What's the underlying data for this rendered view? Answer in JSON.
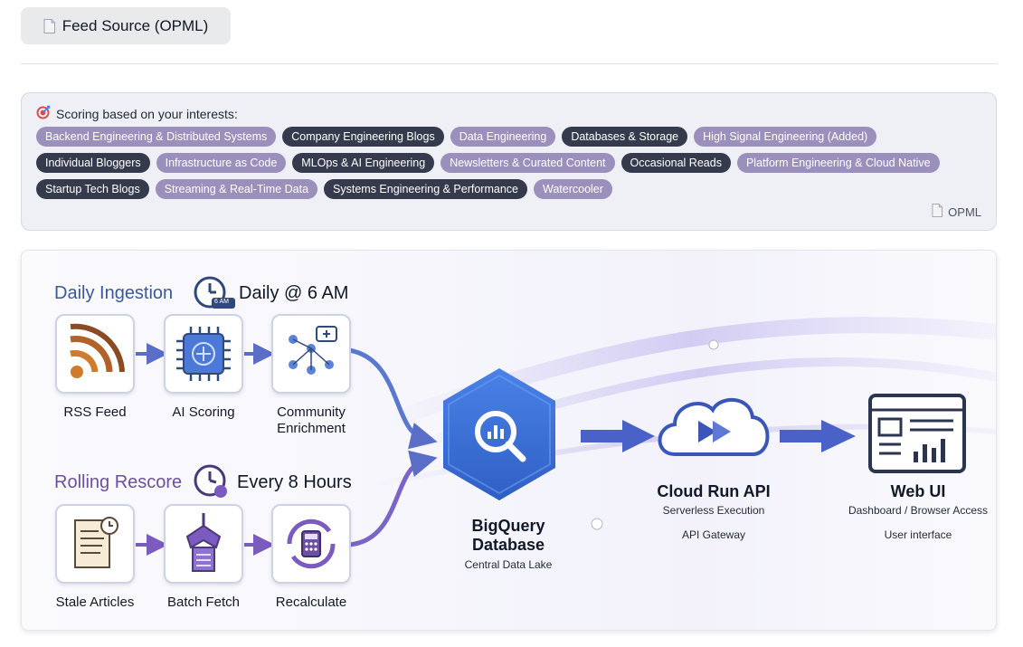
{
  "header": {
    "feed_button_label": "Feed Source (OPML)"
  },
  "interests": {
    "title": "Scoring based on your interests:",
    "rows": [
      [
        {
          "label": "Backend Engineering & Distributed Systems",
          "style": "light"
        },
        {
          "label": "Company Engineering Blogs",
          "style": "dark"
        },
        {
          "label": "Data Engineering",
          "style": "light"
        },
        {
          "label": "Databases & Storage",
          "style": "dark"
        },
        {
          "label": "High Signal Engineering (Added)",
          "style": "light"
        }
      ],
      [
        {
          "label": "Individual Bloggers",
          "style": "dark"
        },
        {
          "label": "Infrastructure as Code",
          "style": "light"
        },
        {
          "label": "MLOps & AI Engineering",
          "style": "dark"
        },
        {
          "label": "Newsletters & Curated Content",
          "style": "light"
        },
        {
          "label": "Occasional Reads",
          "style": "dark"
        },
        {
          "label": "Platform Engineering & Cloud Native",
          "style": "light"
        }
      ],
      [
        {
          "label": "Startup Tech Blogs",
          "style": "dark"
        },
        {
          "label": "Streaming & Real-Time Data",
          "style": "light"
        },
        {
          "label": "Systems Engineering & Performance",
          "style": "dark"
        },
        {
          "label": "Watercooler",
          "style": "light"
        }
      ]
    ],
    "opml_link": "OPML"
  },
  "diagram": {
    "daily": {
      "title": "Daily Ingestion",
      "schedule": "Daily @ 6 AM",
      "clock_badge": "6 AM",
      "steps": [
        "RSS Feed",
        "AI Scoring",
        "Community Enrichment"
      ]
    },
    "rolling": {
      "title": "Rolling Rescore",
      "schedule": "Every 8 Hours",
      "steps": [
        "Stale Articles",
        "Batch Fetch",
        "Recalculate"
      ]
    },
    "bigquery": {
      "title": "BigQuery Database",
      "subtitle": "Central Data Lake"
    },
    "cloud_run": {
      "title": "Cloud Run API",
      "subtitle": "Serverless Execution",
      "detail": "API Gateway"
    },
    "web_ui": {
      "title": "Web UI",
      "subtitle": "Dashboard / Browser Access",
      "detail": "User interface"
    }
  },
  "colors": {
    "tag_light": "#9b8fbb",
    "tag_dark": "#353b4c",
    "daily_title": "#3b5998",
    "rolling_title": "#6d4fa0",
    "bigquery_blue": "#3b6fd6"
  }
}
